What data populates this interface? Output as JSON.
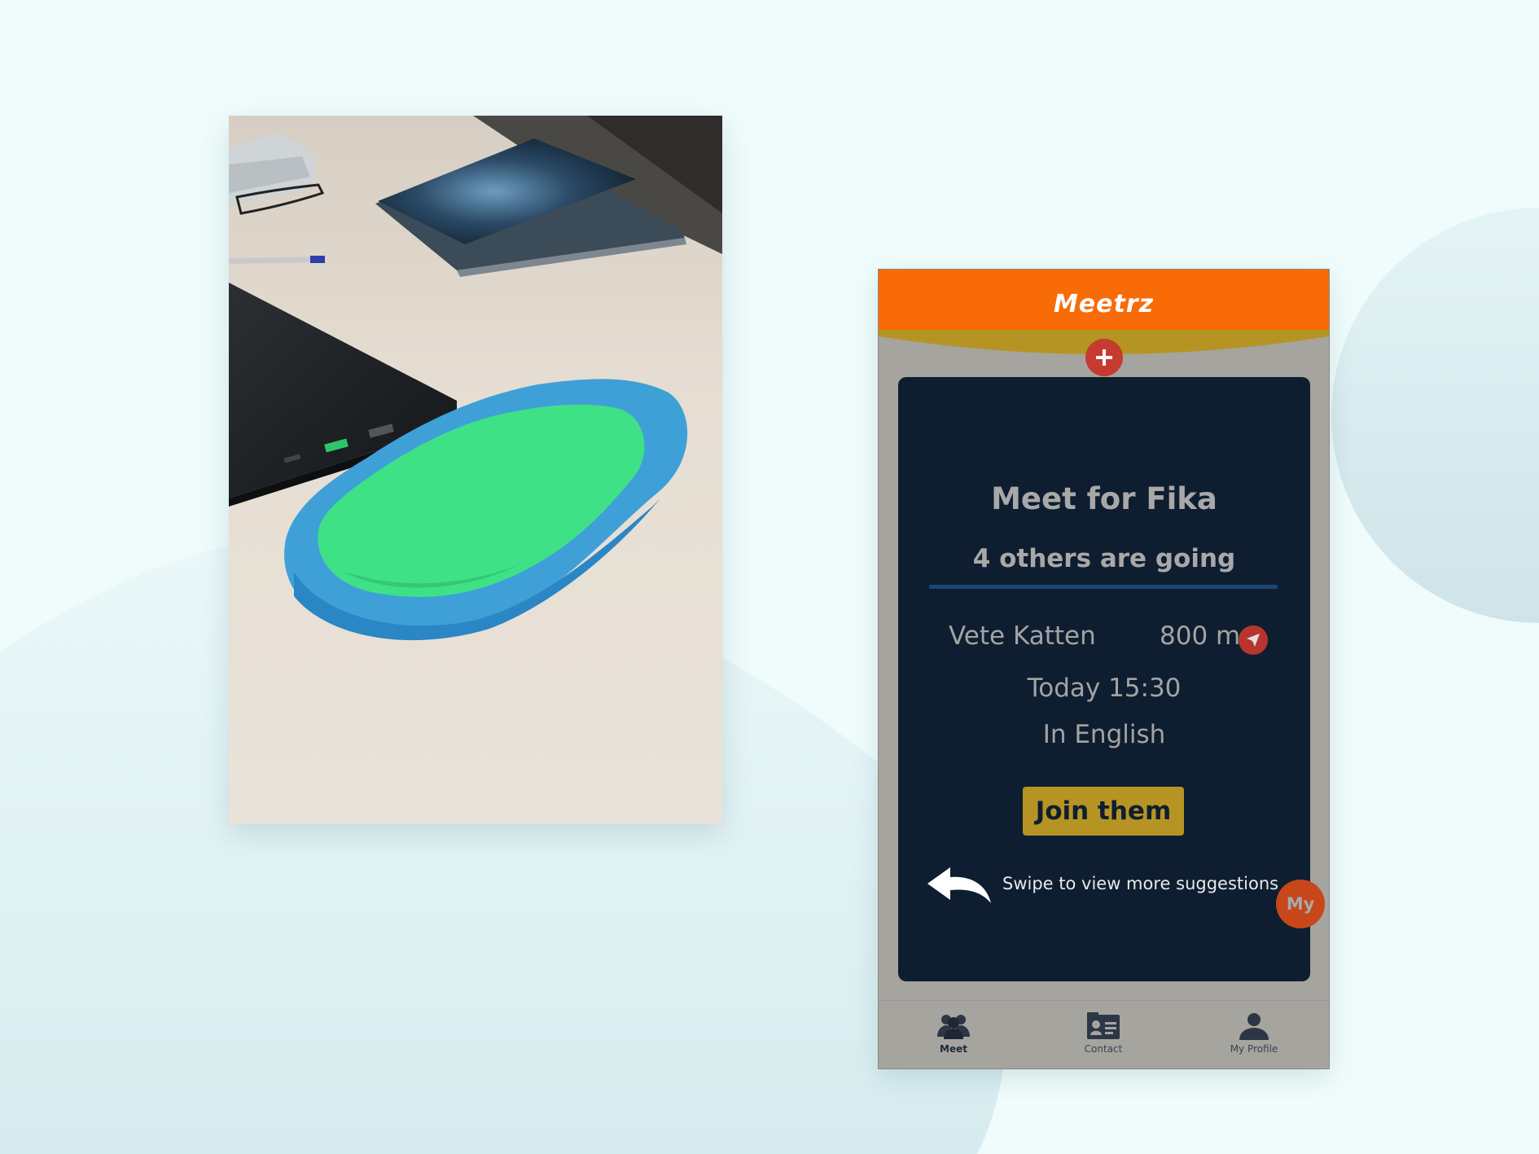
{
  "app": {
    "logo": "Meetrz"
  },
  "meetup": {
    "title": "Meet for Fika",
    "attendees": "4 others are going",
    "place": "Vete Katten",
    "distance": "800 m",
    "time": "Today 15:30",
    "language": "In English",
    "join_label": "Join them",
    "swipe_hint": "Swipe to view more suggestions",
    "my_badge": "My"
  },
  "tabs": [
    {
      "label": "Meet",
      "icon": "group-icon",
      "active": true
    },
    {
      "label": "Contact",
      "icon": "contact-card-icon",
      "active": false
    },
    {
      "label": "My Profile",
      "icon": "person-icon",
      "active": false
    }
  ],
  "colors": {
    "header": "#f86b06",
    "card": "#0e1e30",
    "accent_button": "#b59423",
    "add_button": "#c63a30",
    "my_bubble": "#c7461a"
  }
}
